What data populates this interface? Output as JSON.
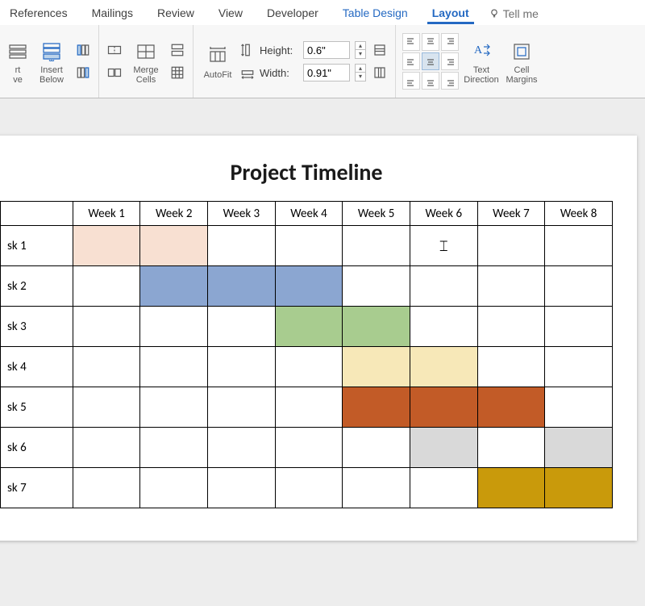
{
  "ribbon": {
    "tabs": [
      "References",
      "Mailings",
      "Review",
      "View",
      "Developer",
      "Table Design",
      "Layout"
    ],
    "active_tab": "Layout",
    "tell_me": "Tell me",
    "insert_rt_label": "rt\nve",
    "insert_below_label": "Insert\nBelow",
    "merge_label": "Merge\nCells",
    "autofit_label": "AutoFit",
    "height_label": "Height:",
    "width_label": "Width:",
    "height_value": "0.6\"",
    "width_value": "0.91\"",
    "text_direction_label": "Text\nDirection",
    "cell_margins_label": "Cell\nMargins"
  },
  "doc": {
    "title": "Project Timeline",
    "weeks": [
      "Week 1",
      "Week 2",
      "Week 3",
      "Week 4",
      "Week 5",
      "Week 6",
      "Week 7",
      "Week 8"
    ],
    "tasks": [
      {
        "name": "sk 1",
        "cells": [
          "#f8e0d2",
          "#f8e0d2",
          "",
          "",
          "",
          "",
          "",
          ""
        ]
      },
      {
        "name": "sk 2",
        "cells": [
          "",
          "#8ba6d1",
          "#8ba6d1",
          "#8ba6d1",
          "",
          "",
          "",
          ""
        ]
      },
      {
        "name": "sk 3",
        "cells": [
          "",
          "",
          "",
          "#a8cc8f",
          "#a8cc8f",
          "",
          "",
          ""
        ]
      },
      {
        "name": "sk 4",
        "cells": [
          "",
          "",
          "",
          "",
          "#f7e8b8",
          "#f7e8b8",
          "",
          ""
        ]
      },
      {
        "name": "sk 5",
        "cells": [
          "",
          "",
          "",
          "",
          "#c25b27",
          "#c25b27",
          "#c25b27",
          ""
        ]
      },
      {
        "name": "sk 6",
        "cells": [
          "",
          "",
          "",
          "",
          "",
          "#d9d9d9",
          "",
          "#d9d9d9"
        ]
      },
      {
        "name": "sk 7",
        "cells": [
          "",
          "",
          "",
          "",
          "",
          "",
          "#c99a0b",
          "#c99a0b"
        ]
      }
    ]
  }
}
